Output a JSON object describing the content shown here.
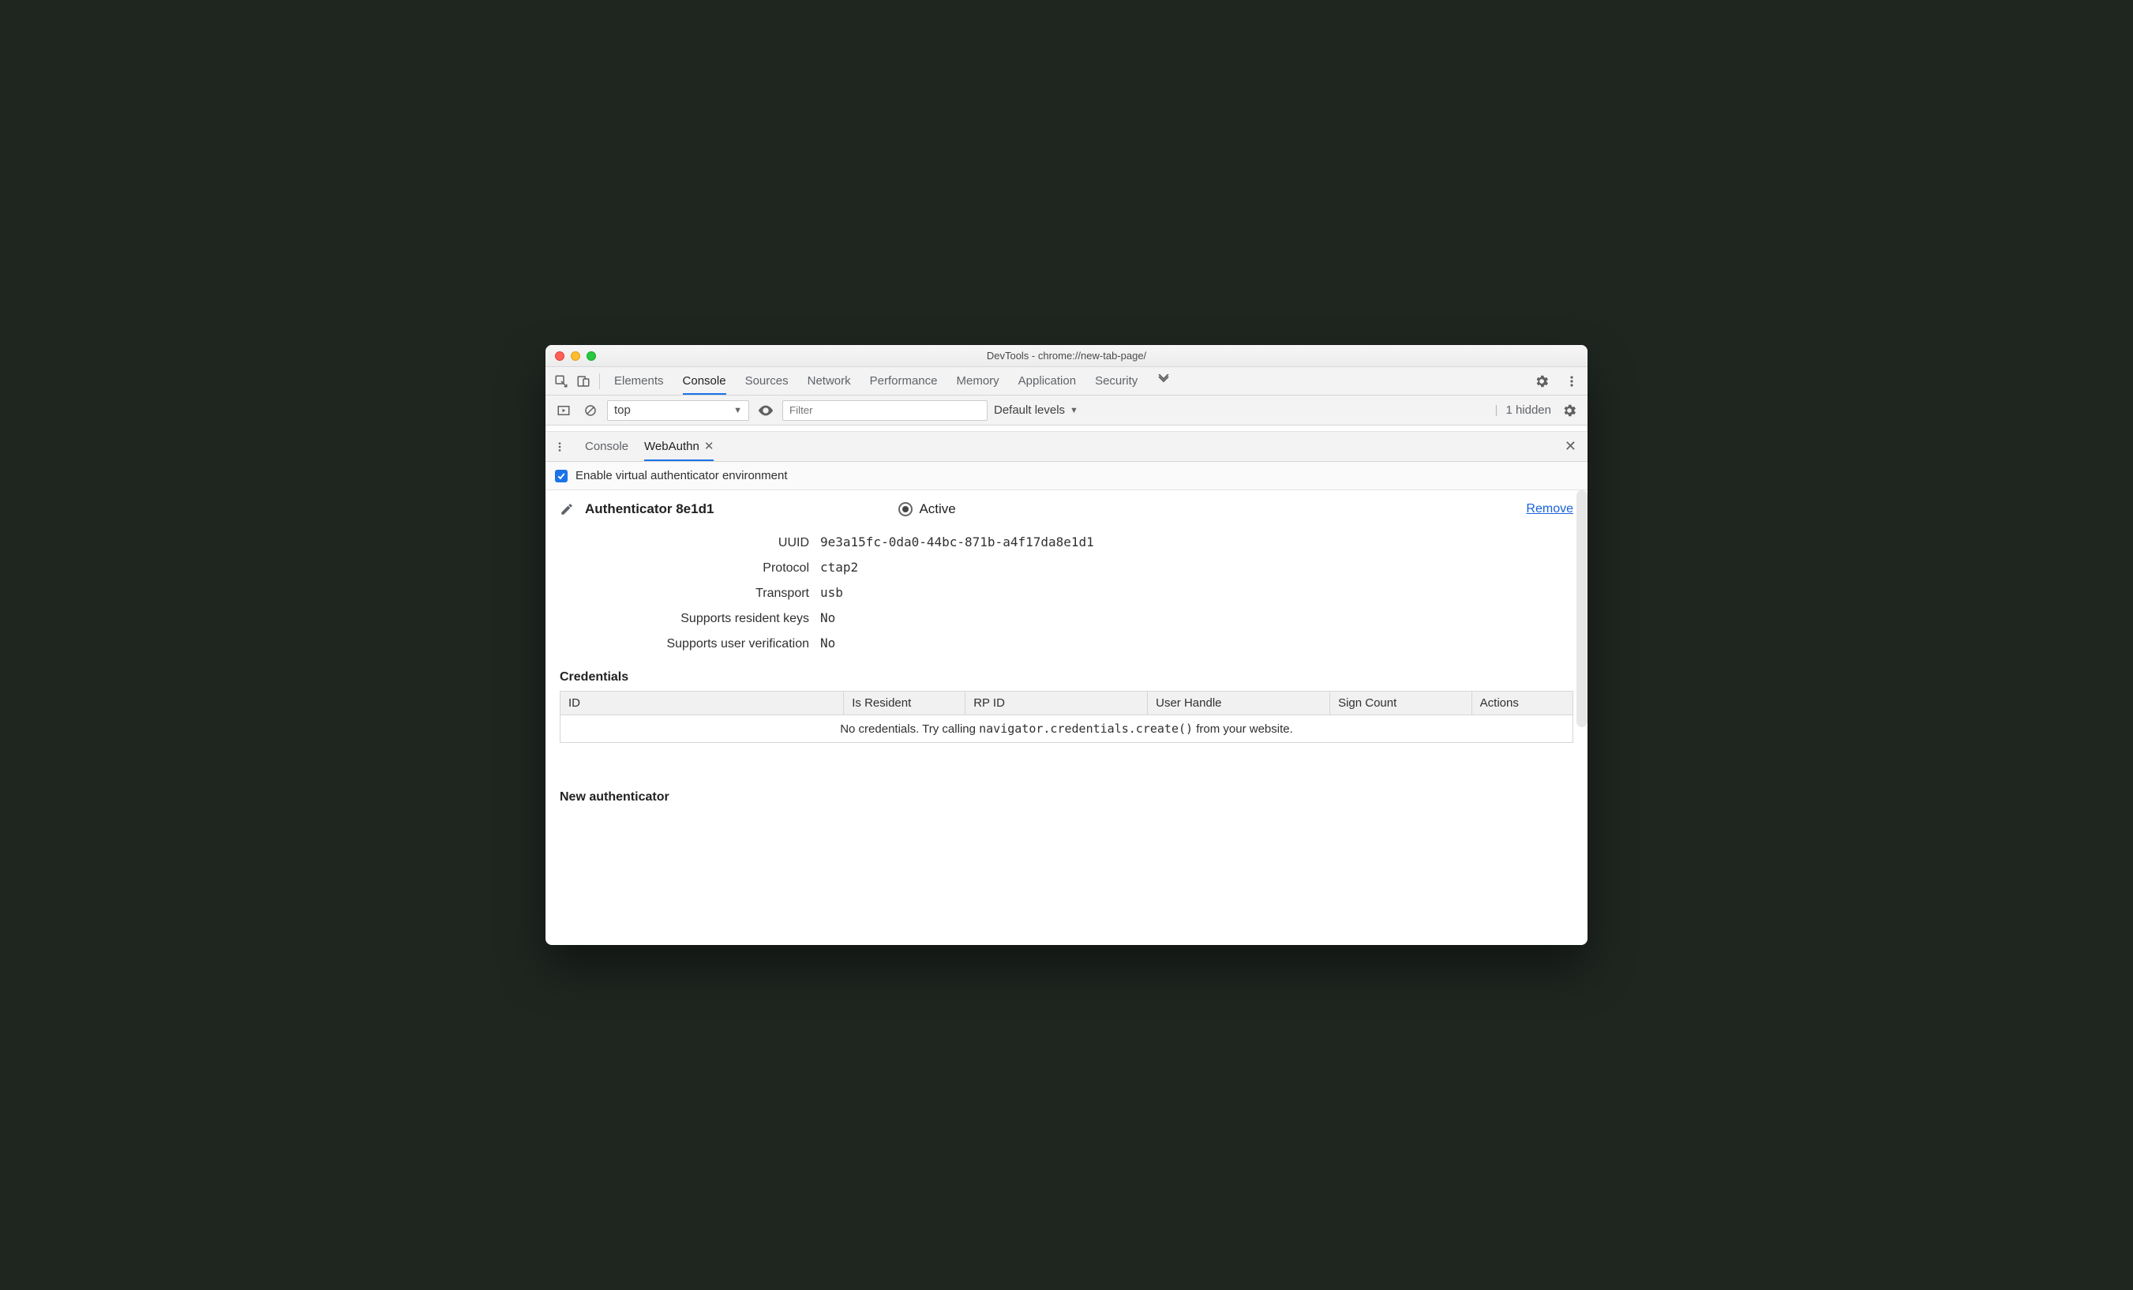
{
  "window": {
    "title": "DevTools - chrome://new-tab-page/"
  },
  "tabs": {
    "items": [
      "Elements",
      "Console",
      "Sources",
      "Network",
      "Performance",
      "Memory",
      "Application",
      "Security"
    ],
    "active": "Console"
  },
  "console_bar": {
    "context": "top",
    "filter_placeholder": "Filter",
    "levels_label": "Default levels",
    "hidden_text": "1 hidden"
  },
  "drawer": {
    "tabs": [
      "Console",
      "WebAuthn"
    ],
    "active": "WebAuthn"
  },
  "enable": {
    "label": "Enable virtual authenticator environment",
    "checked": true
  },
  "authenticator": {
    "title": "Authenticator 8e1d1",
    "active_label": "Active",
    "remove_label": "Remove",
    "fields": {
      "uuid_label": "UUID",
      "uuid": "9e3a15fc-0da0-44bc-871b-a4f17da8e1d1",
      "protocol_label": "Protocol",
      "protocol": "ctap2",
      "transport_label": "Transport",
      "transport": "usb",
      "resident_label": "Supports resident keys",
      "resident": "No",
      "userver_label": "Supports user verification",
      "userver": "No"
    }
  },
  "credentials": {
    "heading": "Credentials",
    "headers": [
      "ID",
      "Is Resident",
      "RP ID",
      "User Handle",
      "Sign Count",
      "Actions"
    ],
    "empty_pre": "No credentials. Try calling ",
    "empty_code": "navigator.credentials.create()",
    "empty_post": " from your website."
  },
  "new_auth": {
    "heading": "New authenticator"
  }
}
